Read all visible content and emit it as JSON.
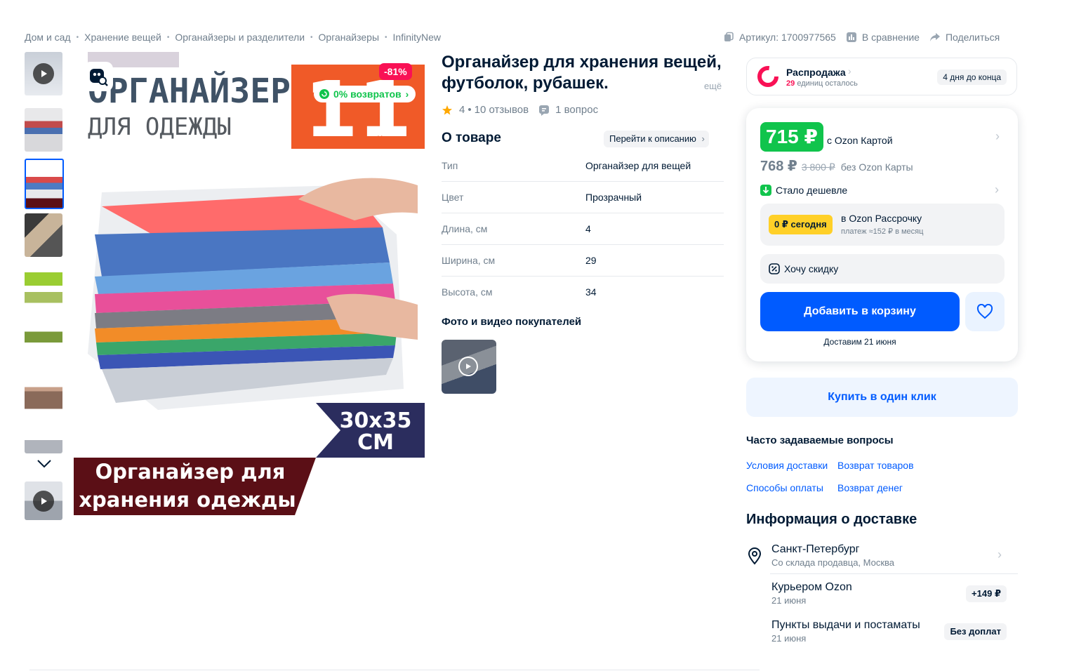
{
  "breadcrumbs": [
    "Дом и сад",
    "Хранение вещей",
    "Органайзеры и разделители",
    "Органайзеры",
    "InfinityNew"
  ],
  "top_actions": {
    "article": "Артикул: 1700977565",
    "compare": "В сравнение",
    "share": "Поделиться"
  },
  "main_image": {
    "discount": "-81%",
    "returns": "0% возвратов",
    "text_top1": "ОРГАНАЙЗЕР",
    "text_top2": "ДЛЯ ОДЕЖДЫ",
    "brand_badge": "ОРГАНАЙЗЕР",
    "size_badge_1": "30x35",
    "size_badge_2": "СМ",
    "banner_1": "Органайзер для",
    "banner_2": "хранения одежды"
  },
  "product": {
    "title": "Органайзер для хранения вещей, футболок, рубашек.",
    "more": "ещё",
    "rating": "4",
    "reviews": "10 отзывов",
    "questions": "1 вопрос"
  },
  "about": {
    "heading": "О товаре",
    "go_to_description": "Перейти к описанию",
    "specs": [
      {
        "k": "Тип",
        "v": "Органайзер для вещей"
      },
      {
        "k": "Цвет",
        "v": "Прозрачный"
      },
      {
        "k": "Длина, см",
        "v": "4"
      },
      {
        "k": "Ширина, см",
        "v": "29"
      },
      {
        "k": "Высота, см",
        "v": "34"
      }
    ]
  },
  "buyer_photos": {
    "heading": "Фото и видео покупателей"
  },
  "sale": {
    "label": "Распродажа",
    "remaining_count": "29",
    "remaining_text": "единиц осталось",
    "ends": "4 дня до конца"
  },
  "price": {
    "card_price": "715 ₽",
    "card_label": "с Ozon Картой",
    "regular_price": "768 ₽",
    "old_price": "3 800 ₽",
    "no_card_label": "без Ozon Карты",
    "cheaper": "Стало дешевле",
    "installment_badge": "0 ₽ сегодня",
    "installment_title": "в Ozon Рассрочку",
    "installment_sub": "платеж ≈152 ₽ в месяц",
    "want_discount": "Хочу скидку",
    "add_to_cart": "Добавить в корзину",
    "delivery_date": "Доставим 21 июня"
  },
  "one_click": "Купить в один клик",
  "faq": {
    "heading": "Часто задаваемые вопросы",
    "links": [
      "Условия доставки",
      "Возврат товаров",
      "Способы оплаты",
      "Возврат денег"
    ]
  },
  "delivery": {
    "heading": "Информация о доставке",
    "city": "Санкт-Петербург",
    "warehouse": "Со склада продавца, Москва",
    "options": [
      {
        "title": "Курьером Ozon",
        "date": "21 июня",
        "price": "+149 ₽"
      },
      {
        "title": "Пункты выдачи и постаматы",
        "date": "21 июня",
        "price": "Без доплат"
      }
    ]
  },
  "colors": {
    "accent": "#005bff",
    "green": "#10c44c",
    "pink": "#f91155",
    "orange": "#f05a28",
    "navy": "#2b2d5e",
    "maroon": "#5b0f16"
  }
}
